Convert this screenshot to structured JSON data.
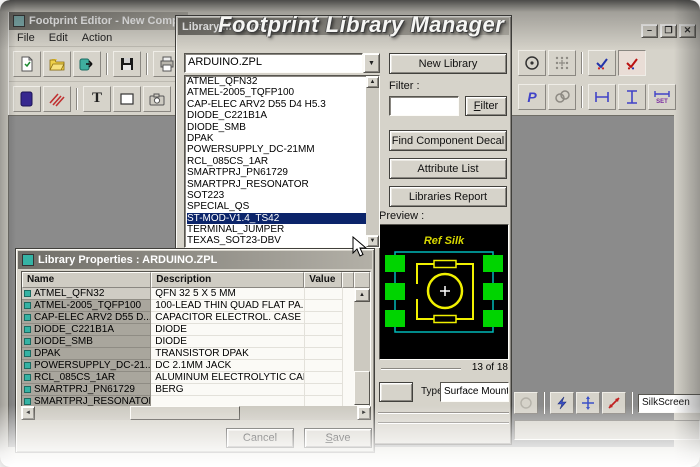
{
  "overlay": {
    "title": "Footprint Library Manager"
  },
  "editor_window": {
    "title": "Footprint Editor - New Comp",
    "menus": [
      "File",
      "Edit",
      "Action"
    ]
  },
  "main_window": {
    "controls": {
      "minimize": "–",
      "maximize": "❐",
      "close": "✕"
    },
    "silkscreen_combo": "SilkScreen"
  },
  "library_manager": {
    "title": "Library Manager",
    "library_dropdown": "ARDUINO.ZPL",
    "parts": [
      "ATMEL_QFN32",
      "ATMEL-2005_TQFP100",
      "CAP-ELEC ARV2 D55 D4 H5.3",
      "DIODE_C221B1A",
      "DIODE_SMB",
      "DPAK",
      "POWERSUPPLY_DC-21MM",
      "RCL_085CS_1AR",
      "SMARTPRJ_PN61729",
      "SMARTPRJ_RESONATOR",
      "SOT223",
      "SPECIAL_QS",
      "ST-MOD-V1.4_TS42",
      "TERMINAL_JUMPER",
      "TEXAS_SOT23-DBV"
    ],
    "selected_part": "ST-MOD-V1.4_TS42",
    "labels": {
      "new_library": "New Library",
      "filter_label": "Filter :",
      "filter_button": "Filter",
      "find_component_decal": "Find Component Decal",
      "attribute_list": "Attribute List",
      "libraries_report": "Libraries Report",
      "preview_label": "Preview :",
      "type_label": "Type"
    },
    "filter_value": "",
    "counter": "13 of 18",
    "type_value": "Surface Mount",
    "preview": {
      "ref_label": "Ref Silk"
    }
  },
  "library_properties": {
    "title": "Library Properties : ARDUINO.ZPL",
    "columns": [
      "Name",
      "Description",
      "Value"
    ],
    "rows": [
      {
        "name": "ATMEL_QFN32",
        "description": "QFN 32 5 X 5 MM",
        "value": ""
      },
      {
        "name": "ATMEL-2005_TQFP100",
        "description": "100-LEAD THIN QUAD FLAT PA...",
        "value": ""
      },
      {
        "name": "CAP-ELEC ARV2 D55 D...",
        "description": "CAPACITOR ELECTROL. CASE D...",
        "value": ""
      },
      {
        "name": "DIODE_C221B1A",
        "description": "DIODE",
        "value": ""
      },
      {
        "name": "DIODE_SMB",
        "description": "DIODE",
        "value": ""
      },
      {
        "name": "DPAK",
        "description": "TRANSISTOR DPAK",
        "value": ""
      },
      {
        "name": "POWERSUPPLY_DC-21...",
        "description": "DC 2.1MM JACK",
        "value": ""
      },
      {
        "name": "RCL_085CS_1AR",
        "description": "ALUMINUM ELECTROLYTIC CAP...",
        "value": ""
      },
      {
        "name": "SMARTPRJ_PN61729",
        "description": "BERG",
        "value": ""
      },
      {
        "name": "SMARTPRJ_RESONATOR",
        "description": "",
        "value": ""
      }
    ],
    "buttons": {
      "cancel": "Cancel",
      "save": "Save"
    }
  },
  "icons": {
    "text_tool": "T",
    "pour_tool": "P",
    "set_dim": "SET",
    "dropdown_arrow": "▼",
    "scroll_up": "▲",
    "scroll_down": "▼",
    "scroll_left": "◄",
    "scroll_right": "►"
  },
  "colors": {
    "selection": "#0b246a",
    "canvas": "#8b8b8b",
    "pad_green": "#00d400",
    "silk_yellow": "#f0f000",
    "outline_cyan": "#00b8b8"
  }
}
